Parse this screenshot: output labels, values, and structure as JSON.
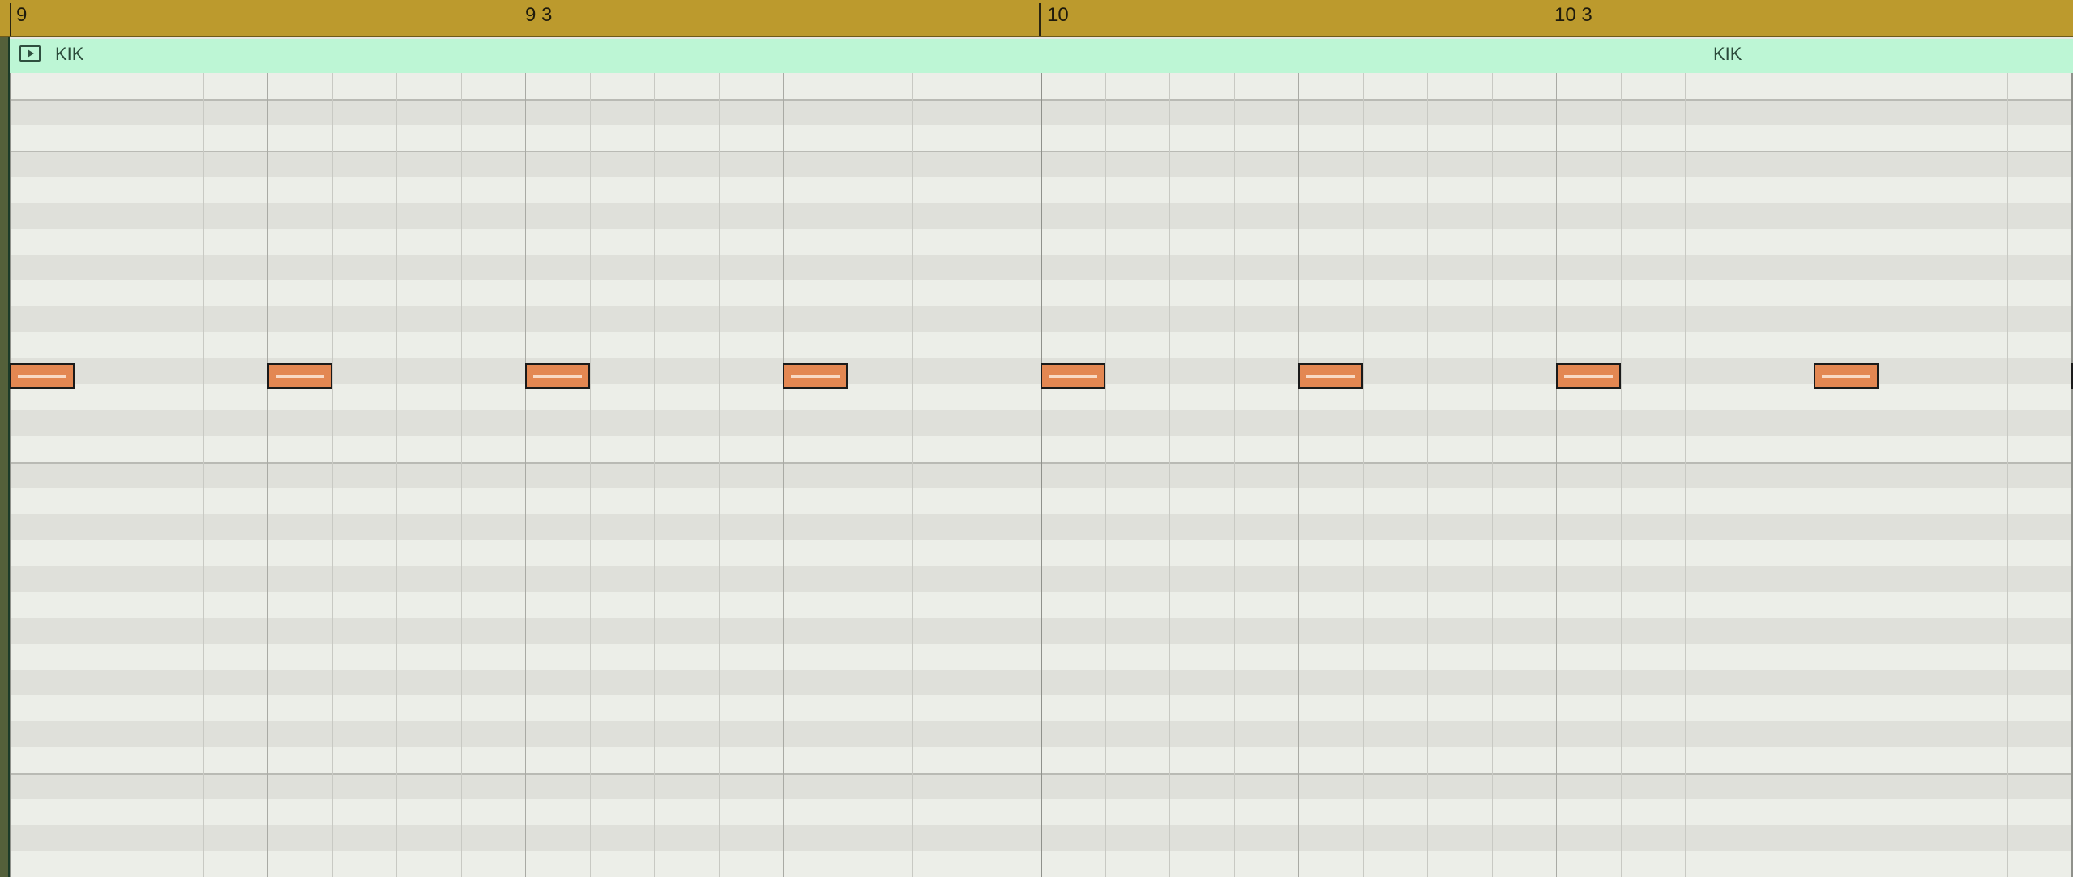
{
  "ruler": {
    "labels": [
      "9",
      "9 3",
      "10",
      "10 3"
    ]
  },
  "region": {
    "name_primary": "KIK",
    "name_secondary": "KIK",
    "color": "#bdf6d5"
  },
  "colors": {
    "ruler_bg": "#bc9a2d",
    "note_fill": "#e38752",
    "lane_light": "#eceee8",
    "lane_dark": "#dfe0da"
  },
  "grid": {
    "bars": [
      9,
      10
    ],
    "beats_per_bar": 4,
    "divisions_per_beat": 4
  },
  "notes": {
    "pitch_lane": 15,
    "start_beats": [
      0,
      1,
      2,
      3,
      4,
      5,
      6,
      7,
      8
    ],
    "length_sixteenths": 1
  }
}
